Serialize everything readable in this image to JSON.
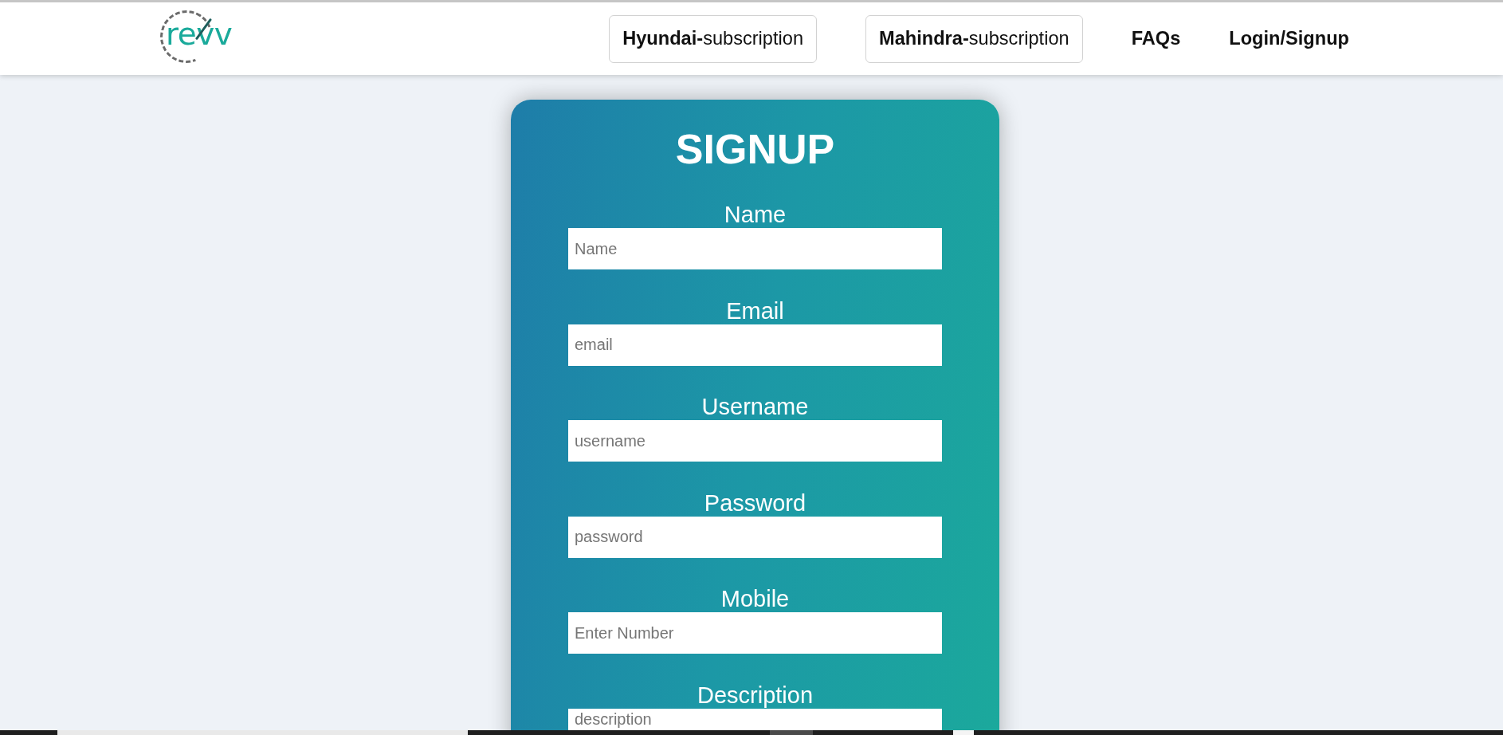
{
  "header": {
    "logo": {
      "text": "revv"
    },
    "nav": [
      {
        "kind": "outlined",
        "label": "**Hyundai-**subscription"
      },
      {
        "kind": "outlined",
        "label": "**Mahindra-**subscription"
      },
      {
        "kind": "link",
        "label": "FAQs"
      },
      {
        "kind": "link",
        "label": "Login/Signup"
      }
    ]
  },
  "signup_form": {
    "title": "SIGNUP",
    "fields": [
      {
        "label": "Name",
        "placeholder": "Name"
      },
      {
        "label": "Email",
        "placeholder": "email"
      },
      {
        "label": "Username",
        "placeholder": "username"
      },
      {
        "label": "Password",
        "placeholder": "password"
      },
      {
        "label": "Mobile",
        "placeholder": "Enter Number"
      },
      {
        "label": "Description",
        "placeholder": "description"
      }
    ]
  }
}
